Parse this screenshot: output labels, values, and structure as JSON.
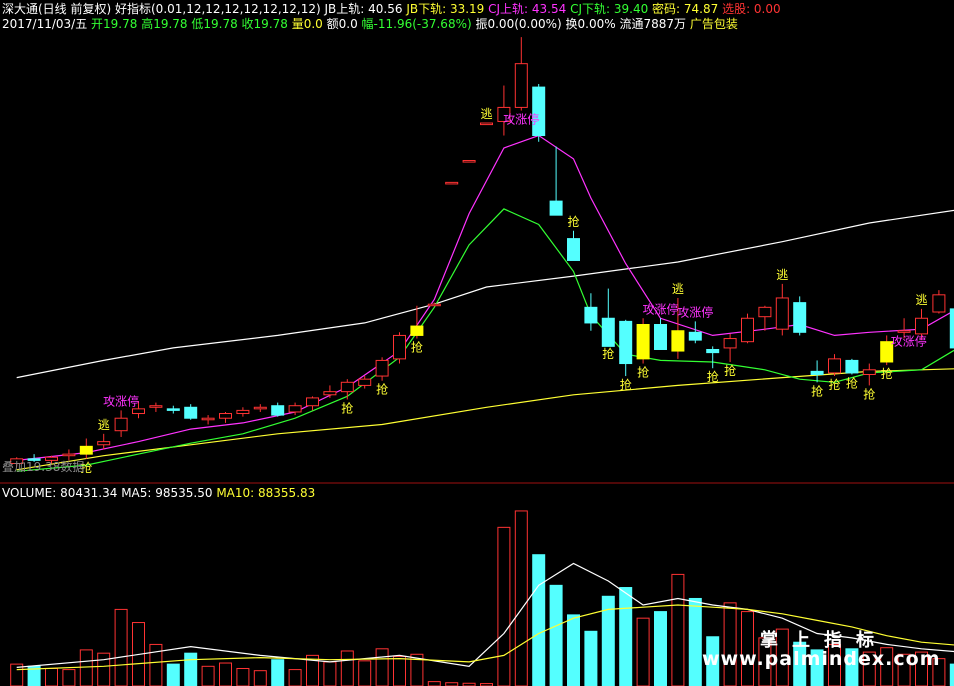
{
  "header": {
    "line1": [
      {
        "text": "深大通(日线 前复权)",
        "color": "#ffffff"
      },
      {
        "text": " 好指标(0.01,12,12,12,12,12,12,12) ",
        "color": "#ffffff"
      },
      {
        "text": "JB上轨: 40.56 ",
        "color": "#ffffff"
      },
      {
        "text": "JB下轨: 33.19 ",
        "color": "#ffff33"
      },
      {
        "text": "CJ上轨: 43.54 ",
        "color": "#ff33ff"
      },
      {
        "text": "CJ下轨: 39.40 ",
        "color": "#33ff33"
      },
      {
        "text": "       密码: 74.87 ",
        "color": "#ffff33"
      },
      {
        "text": "选股: 0.00",
        "color": "#ff3333"
      }
    ],
    "line2": [
      {
        "text": "2017/11/03/五 ",
        "color": "#ffffff"
      },
      {
        "text": "开19.78 ",
        "color": "#33ff33"
      },
      {
        "text": "高19.78 ",
        "color": "#33ff33"
      },
      {
        "text": "低19.78 ",
        "color": "#33ff33"
      },
      {
        "text": "收19.78 ",
        "color": "#33ff33"
      },
      {
        "text": "量0.0 ",
        "color": "#ffff33"
      },
      {
        "text": "额0.0 ",
        "color": "#ffffff"
      },
      {
        "text": "幅-11.96(-37.68%) ",
        "color": "#33ff33"
      },
      {
        "text": "振0.00(0.00%) ",
        "color": "#ffffff"
      },
      {
        "text": "换0.00% ",
        "color": "#ffffff"
      },
      {
        "text": "流通7887万 ",
        "color": "#ffffff"
      },
      {
        "text": "广告包装",
        "color": "#ffff33"
      }
    ]
  },
  "volume_header": [
    {
      "text": "VOLUME: 80431.34  ",
      "color": "#ffffff"
    },
    {
      "text": "MA5: 98535.50  ",
      "color": "#ffffff"
    },
    {
      "text": "MA10: 88355.83",
      "color": "#ffff33"
    }
  ],
  "ghost_text": "叠加19.38数据",
  "watermark": {
    "line1": "掌上指标",
    "line2": "www.palmindex.com"
  },
  "colors": {
    "up": "#ff3333",
    "down": "#54ffff",
    "flag": "#ffff00",
    "jb_upper": "#ffffff",
    "jb_lower": "#ffff33",
    "cj_upper": "#ff33ff",
    "cj_lower": "#33ff33",
    "vol_ma5": "#ffffff",
    "vol_ma10": "#ffff33",
    "signal_text": "#ffff33",
    "zt_text": "#ff33ff",
    "separator": "#a01010"
  },
  "chart_data": {
    "type": "candlestick",
    "price_range": [
      15.2,
      43.5
    ],
    "volume_range": [
      0,
      170000
    ],
    "candles": [
      {
        "o": 16.0,
        "h": 16.4,
        "l": 15.8,
        "c": 16.3,
        "v": 20000
      },
      {
        "o": 16.3,
        "h": 16.6,
        "l": 16.1,
        "c": 16.2,
        "v": 18000
      },
      {
        "o": 16.2,
        "h": 16.5,
        "l": 16.0,
        "c": 16.4,
        "v": 16000
      },
      {
        "o": 16.5,
        "h": 16.9,
        "l": 16.2,
        "c": 16.6,
        "v": 15000
      },
      {
        "o": 16.6,
        "h": 17.6,
        "l": 16.3,
        "c": 17.1,
        "v": 33000,
        "flag": true
      },
      {
        "o": 17.2,
        "h": 17.9,
        "l": 16.9,
        "c": 17.4,
        "v": 30000
      },
      {
        "o": 18.1,
        "h": 19.4,
        "l": 17.7,
        "c": 18.9,
        "v": 70000
      },
      {
        "o": 19.2,
        "h": 20.0,
        "l": 18.9,
        "c": 19.5,
        "v": 58000
      },
      {
        "o": 19.6,
        "h": 19.9,
        "l": 19.3,
        "c": 19.7,
        "v": 38000
      },
      {
        "o": 19.5,
        "h": 19.7,
        "l": 19.2,
        "c": 19.4,
        "v": 20000
      },
      {
        "o": 19.6,
        "h": 19.8,
        "l": 18.8,
        "c": 18.9,
        "v": 30000
      },
      {
        "o": 18.8,
        "h": 19.1,
        "l": 18.5,
        "c": 18.9,
        "v": 18000
      },
      {
        "o": 18.9,
        "h": 19.3,
        "l": 18.6,
        "c": 19.2,
        "v": 21000
      },
      {
        "o": 19.2,
        "h": 19.6,
        "l": 19.0,
        "c": 19.4,
        "v": 16000
      },
      {
        "o": 19.5,
        "h": 19.8,
        "l": 19.3,
        "c": 19.6,
        "v": 14000
      },
      {
        "o": 19.7,
        "h": 19.9,
        "l": 19.0,
        "c": 19.1,
        "v": 24000
      },
      {
        "o": 19.3,
        "h": 19.9,
        "l": 19.1,
        "c": 19.7,
        "v": 15000
      },
      {
        "o": 19.7,
        "h": 20.3,
        "l": 19.4,
        "c": 20.2,
        "v": 28000
      },
      {
        "o": 20.4,
        "h": 21.0,
        "l": 20.2,
        "c": 20.6,
        "v": 22000
      },
      {
        "o": 20.6,
        "h": 21.4,
        "l": 20.1,
        "c": 21.2,
        "v": 32000
      },
      {
        "o": 21.0,
        "h": 21.6,
        "l": 20.8,
        "c": 21.4,
        "v": 23000
      },
      {
        "o": 21.6,
        "h": 22.8,
        "l": 21.3,
        "c": 22.6,
        "v": 34000
      },
      {
        "o": 22.7,
        "h": 24.4,
        "l": 22.4,
        "c": 24.2,
        "v": 27000
      },
      {
        "o": 24.2,
        "h": 26.1,
        "l": 24.0,
        "c": 24.8,
        "v": 29000,
        "flag": true
      },
      {
        "o": 26.2,
        "h": 26.3,
        "l": 26.2,
        "c": 26.2,
        "v": 4000
      },
      {
        "o": 33.9,
        "h": 34.0,
        "l": 33.9,
        "c": 34.0,
        "v": 3000
      },
      {
        "o": 35.3,
        "h": 35.4,
        "l": 35.3,
        "c": 35.4,
        "v": 2500
      },
      {
        "o": 37.7,
        "h": 37.8,
        "l": 37.7,
        "c": 37.8,
        "v": 2200
      },
      {
        "o": 37.9,
        "h": 40.2,
        "l": 37.0,
        "c": 38.8,
        "v": 145000
      },
      {
        "o": 38.8,
        "h": 43.3,
        "l": 38.6,
        "c": 41.6,
        "v": 160000
      },
      {
        "o": 40.1,
        "h": 40.3,
        "l": 36.6,
        "c": 37.0,
        "v": 120000
      },
      {
        "o": 32.8,
        "h": 36.3,
        "l": 32.0,
        "c": 31.9,
        "v": 92000
      },
      {
        "o": 30.4,
        "h": 30.9,
        "l": 29.1,
        "c": 29.0,
        "v": 65000
      },
      {
        "o": 26.0,
        "h": 26.9,
        "l": 24.5,
        "c": 25.0,
        "v": 50000
      },
      {
        "o": 25.3,
        "h": 27.2,
        "l": 23.6,
        "c": 23.5,
        "v": 82000
      },
      {
        "o": 25.1,
        "h": 25.2,
        "l": 21.6,
        "c": 22.4,
        "v": 90000
      },
      {
        "o": 22.7,
        "h": 25.3,
        "l": 22.4,
        "c": 24.9,
        "v": 62000,
        "flag": true
      },
      {
        "o": 24.9,
        "h": 25.3,
        "l": 23.8,
        "c": 23.3,
        "v": 68000
      },
      {
        "o": 23.2,
        "h": 26.6,
        "l": 22.7,
        "c": 24.5,
        "v": 102000,
        "flag": true
      },
      {
        "o": 24.4,
        "h": 25.1,
        "l": 23.7,
        "c": 23.9,
        "v": 80000
      },
      {
        "o": 23.3,
        "h": 23.5,
        "l": 22.1,
        "c": 23.1,
        "v": 45000
      },
      {
        "o": 23.4,
        "h": 24.3,
        "l": 22.5,
        "c": 24.0,
        "v": 76000
      },
      {
        "o": 23.8,
        "h": 25.6,
        "l": 23.7,
        "c": 25.3,
        "v": 68000
      },
      {
        "o": 25.4,
        "h": 26.1,
        "l": 24.5,
        "c": 26.0,
        "v": 44000
      },
      {
        "o": 24.6,
        "h": 27.5,
        "l": 24.2,
        "c": 26.6,
        "v": 52000
      },
      {
        "o": 26.3,
        "h": 26.7,
        "l": 24.2,
        "c": 24.4,
        "v": 40000
      },
      {
        "o": 21.9,
        "h": 22.6,
        "l": 21.2,
        "c": 21.7,
        "v": 33000
      },
      {
        "o": 21.8,
        "h": 23.0,
        "l": 21.6,
        "c": 22.7,
        "v": 38000
      },
      {
        "o": 22.6,
        "h": 22.7,
        "l": 21.7,
        "c": 21.8,
        "v": 34000
      },
      {
        "o": 21.7,
        "h": 22.4,
        "l": 21.0,
        "c": 22.0,
        "v": 31000
      },
      {
        "o": 22.5,
        "h": 24.2,
        "l": 22.3,
        "c": 23.8,
        "v": 35000,
        "flag": true
      },
      {
        "o": 24.4,
        "h": 25.3,
        "l": 24.0,
        "c": 24.5,
        "v": 29000
      },
      {
        "o": 24.3,
        "h": 25.9,
        "l": 23.9,
        "c": 25.3,
        "v": 31000
      },
      {
        "o": 25.7,
        "h": 27.1,
        "l": 25.6,
        "c": 26.8,
        "v": 25000
      },
      {
        "o": 25.9,
        "h": 26.1,
        "l": 23.0,
        "c": 23.4,
        "v": 20000
      }
    ],
    "jb_upper": [
      [
        0,
        21.5
      ],
      [
        5,
        22.6
      ],
      [
        9,
        23.4
      ],
      [
        15,
        24.2
      ],
      [
        20,
        25.0
      ],
      [
        24,
        26.2
      ],
      [
        27,
        27.3
      ],
      [
        32,
        28.0
      ],
      [
        38,
        28.9
      ],
      [
        44,
        30.2
      ],
      [
        49,
        31.4
      ],
      [
        55,
        32.4
      ]
    ],
    "jb_lower": [
      [
        0,
        15.6
      ],
      [
        5,
        16.5
      ],
      [
        10,
        17.2
      ],
      [
        15,
        17.9
      ],
      [
        21,
        18.5
      ],
      [
        27,
        19.6
      ],
      [
        32,
        20.4
      ],
      [
        38,
        21.0
      ],
      [
        44,
        21.5
      ],
      [
        49,
        21.9
      ],
      [
        55,
        22.1
      ]
    ],
    "cj_upper": [
      [
        0,
        16.2
      ],
      [
        4,
        16.7
      ],
      [
        7,
        17.4
      ],
      [
        10,
        18.2
      ],
      [
        13,
        18.6
      ],
      [
        16,
        19.3
      ],
      [
        19,
        20.9
      ],
      [
        22,
        23.2
      ],
      [
        24,
        26.5
      ],
      [
        26,
        32.0
      ],
      [
        28,
        36.2
      ],
      [
        30,
        37.0
      ],
      [
        32,
        35.5
      ],
      [
        33,
        33.0
      ],
      [
        35,
        28.8
      ],
      [
        37,
        25.3
      ],
      [
        40,
        24.2
      ],
      [
        43,
        24.6
      ],
      [
        45,
        24.9
      ],
      [
        47,
        24.2
      ],
      [
        49,
        24.4
      ],
      [
        52,
        24.6
      ],
      [
        55,
        26.5
      ]
    ],
    "cj_lower": [
      [
        0,
        15.5
      ],
      [
        4,
        15.9
      ],
      [
        7,
        16.6
      ],
      [
        10,
        17.3
      ],
      [
        13,
        17.9
      ],
      [
        16,
        18.9
      ],
      [
        19,
        20.3
      ],
      [
        22,
        22.8
      ],
      [
        24,
        26.0
      ],
      [
        26,
        30.0
      ],
      [
        28,
        32.3
      ],
      [
        30,
        31.3
      ],
      [
        32,
        28.3
      ],
      [
        33,
        25.5
      ],
      [
        35,
        23.0
      ],
      [
        37,
        22.6
      ],
      [
        40,
        22.5
      ],
      [
        43,
        22.0
      ],
      [
        45,
        21.4
      ],
      [
        47,
        21.2
      ],
      [
        49,
        21.8
      ],
      [
        52,
        22.0
      ],
      [
        55,
        24.0
      ]
    ],
    "vol_ma5": [
      [
        0,
        17000
      ],
      [
        5,
        24000
      ],
      [
        10,
        36000
      ],
      [
        14,
        28000
      ],
      [
        18,
        22000
      ],
      [
        22,
        28000
      ],
      [
        26,
        18000
      ],
      [
        28,
        48000
      ],
      [
        30,
        92000
      ],
      [
        32,
        112000
      ],
      [
        34,
        96000
      ],
      [
        36,
        74000
      ],
      [
        38,
        80000
      ],
      [
        40,
        74000
      ],
      [
        42,
        70000
      ],
      [
        44,
        62000
      ],
      [
        46,
        48000
      ],
      [
        48,
        44000
      ],
      [
        50,
        38000
      ],
      [
        52,
        34000
      ],
      [
        55,
        30000
      ]
    ],
    "vol_ma10": [
      [
        0,
        15000
      ],
      [
        5,
        18000
      ],
      [
        10,
        24000
      ],
      [
        14,
        26000
      ],
      [
        18,
        24000
      ],
      [
        22,
        25000
      ],
      [
        26,
        22000
      ],
      [
        28,
        28000
      ],
      [
        30,
        48000
      ],
      [
        32,
        62000
      ],
      [
        34,
        70000
      ],
      [
        36,
        72000
      ],
      [
        38,
        74000
      ],
      [
        40,
        72000
      ],
      [
        42,
        70000
      ],
      [
        44,
        66000
      ],
      [
        46,
        60000
      ],
      [
        48,
        54000
      ],
      [
        50,
        46000
      ],
      [
        52,
        40000
      ],
      [
        55,
        36000
      ]
    ],
    "signals": [
      {
        "i": 4,
        "text": "抢",
        "pos": "below",
        "color": "#ffff33"
      },
      {
        "i": 5,
        "text": "逃",
        "pos": "above",
        "color": "#ffff33"
      },
      {
        "i": 6,
        "text": "攻涨停",
        "pos": "above",
        "color": "#ff33ff"
      },
      {
        "i": 19,
        "text": "抢",
        "pos": "below",
        "color": "#ffff33"
      },
      {
        "i": 21,
        "text": "抢",
        "pos": "below",
        "color": "#ffff33"
      },
      {
        "i": 23,
        "text": "抢",
        "pos": "below",
        "color": "#ffff33"
      },
      {
        "i": 27,
        "text": "逃",
        "pos": "above",
        "color": "#ffff33"
      },
      {
        "i": 29,
        "text": "攻涨停",
        "pos": "below",
        "color": "#ff33ff"
      },
      {
        "i": 32,
        "text": "抢",
        "pos": "above",
        "color": "#ffff33"
      },
      {
        "i": 34,
        "text": "抢",
        "pos": "below",
        "color": "#ffff33"
      },
      {
        "i": 35,
        "text": "抢",
        "pos": "below",
        "color": "#ffff33"
      },
      {
        "i": 37,
        "text": "攻涨停",
        "pos": "above",
        "color": "#ff33ff"
      },
      {
        "i": 38,
        "text": "逃",
        "pos": "above",
        "color": "#ffff33"
      },
      {
        "i": 39,
        "text": "攻涨停",
        "pos": "above",
        "color": "#ff33ff"
      },
      {
        "i": 36,
        "text": "抢",
        "pos": "below",
        "color": "#ffff33"
      },
      {
        "i": 40,
        "text": "抢",
        "pos": "below",
        "color": "#ffff33"
      },
      {
        "i": 41,
        "text": "抢",
        "pos": "below",
        "color": "#ffff33"
      },
      {
        "i": 44,
        "text": "逃",
        "pos": "above",
        "color": "#ffff33"
      },
      {
        "i": 46,
        "text": "抢",
        "pos": "below",
        "color": "#ffff33"
      },
      {
        "i": 47,
        "text": "抢",
        "pos": "below",
        "color": "#ffff33"
      },
      {
        "i": 48,
        "text": "抢",
        "pos": "below",
        "color": "#ffff33"
      },
      {
        "i": 49,
        "text": "抢",
        "pos": "below",
        "color": "#ffff33"
      },
      {
        "i": 50,
        "text": "抢",
        "pos": "below",
        "color": "#ffff33"
      },
      {
        "i": 50,
        "text": "攻涨停",
        "pos": "right",
        "color": "#ff33ff"
      },
      {
        "i": 52,
        "text": "逃",
        "pos": "above",
        "color": "#ffff33"
      }
    ]
  }
}
